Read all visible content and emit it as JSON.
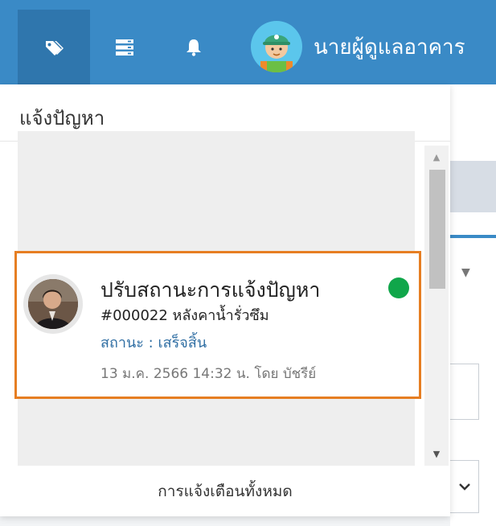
{
  "topbar": {
    "icons": [
      "tags-icon",
      "list-icon",
      "bell-icon"
    ],
    "user_name": "นายผู้ดูแลอาคาร"
  },
  "panel": {
    "title": "แจ้งปัญหา",
    "footer_label": "การแจ้งเตือนทั้งหมด"
  },
  "notification": {
    "title": "ปรับสถานะการแจ้งปัญหา",
    "reference": "#000022 หลังคาน้ำรั่วซึม",
    "status": "สถานะ : เสร็จสิ้น",
    "meta": "13 ม.ค. 2566 14:32 น. โดย บัชรีย์",
    "unread": true
  },
  "colors": {
    "topbar": "#3a8ac6",
    "highlight_border": "#e67e22",
    "status_text": "#2f6ea3",
    "unread_dot": "#10a64a"
  }
}
